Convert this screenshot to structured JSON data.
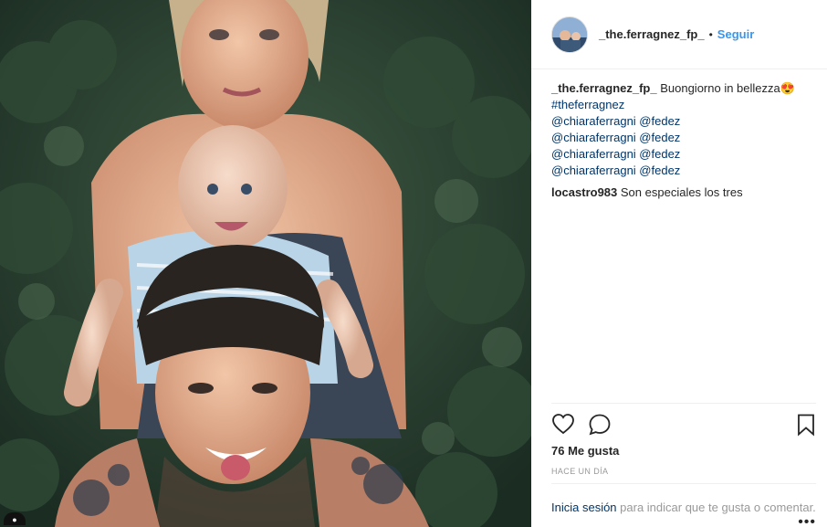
{
  "post": {
    "username": "_the.ferragnez_fp_",
    "separator": "•",
    "follow_label": "Seguir",
    "caption_username": "_the.ferragnez_fp_",
    "caption_text": "Buongiorno in bellezza😍",
    "hashtag": "#theferragnez",
    "mentions": [
      "@chiaraferragni @fedez",
      "@chiaraferragni @fedez",
      "@chiaraferragni @fedez",
      "@chiaraferragni @fedez"
    ],
    "comment": {
      "username": "locastro983",
      "text": "Son especiales los tres"
    },
    "likes_label": "76 Me gusta",
    "timestamp": "HACE UN DÍA",
    "login_link": "Inicia sesión",
    "login_text": " para indicar que te gusta o comentar.",
    "more_dots": "•••"
  },
  "icons": [
    "heart-icon",
    "comment-icon",
    "bookmark-icon",
    "more-icon"
  ],
  "colors": {
    "link_blue": "#3897f0",
    "mention_navy": "#003569",
    "muted_gray": "#999999"
  }
}
